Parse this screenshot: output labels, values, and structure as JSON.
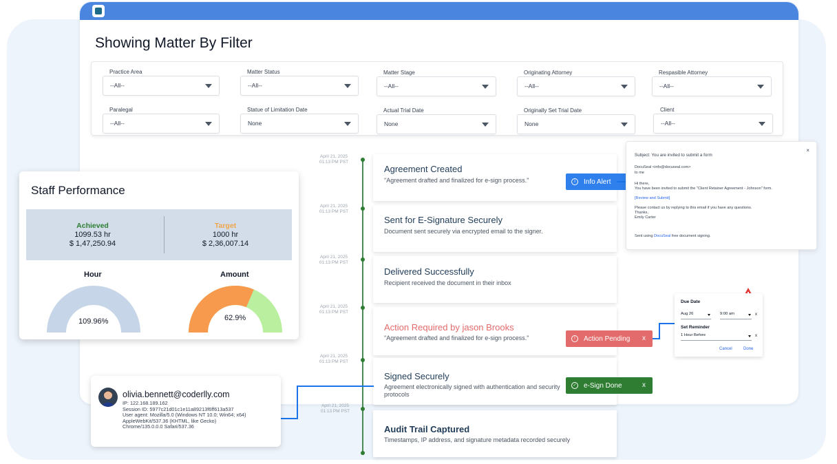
{
  "page_title": "Showing Matter By Filter",
  "filters": [
    {
      "label": "Practice Area",
      "value": "--All--"
    },
    {
      "label": "Matter Status",
      "value": "--All--"
    },
    {
      "label": "Matter Stage",
      "value": "--All--"
    },
    {
      "label": "Originating Attorney",
      "value": "--All--"
    },
    {
      "label": "Respasible Attorney",
      "value": "--All--"
    },
    {
      "label": "Paralegal",
      "value": "--All--"
    },
    {
      "label": "Statue of Limitation Date",
      "value": "None"
    },
    {
      "label": "Actual Trial Date",
      "value": "None"
    },
    {
      "label": "Originally Set Trial Date",
      "value": "None"
    },
    {
      "label": "Client",
      "value": "--All--"
    }
  ],
  "timeline": {
    "date_line1": "April 21, 2025",
    "date_line2": "01:13 PM PST",
    "events": [
      {
        "title": "Agreement Created",
        "desc": "\"Agreement drafted and finalized for e-sign process.\""
      },
      {
        "title": "Sent for E-Signature Securely",
        "desc": "Document sent securely via encrypted email to the signer."
      },
      {
        "title": "Delivered Successfully",
        "desc": "Recipient received the document in their inbox"
      },
      {
        "title": "Action Required by jason Brooks",
        "desc": "\"Agreement drafted and finalized for e-sign process.\""
      },
      {
        "title": "Signed Securely",
        "desc": "Agreement electronically signed with authentication and security protocols"
      },
      {
        "title": "Audit Trail Captured",
        "desc": "Timestamps, IP address, and signature metadata recorded securely"
      }
    ]
  },
  "chips": {
    "info": "Info Alert",
    "pending": "Action Pending",
    "done": "e-Sign Done",
    "close": "x"
  },
  "staff": {
    "title": "Staff Performance",
    "achieved_label": "Achieved",
    "achieved_hours": "1099.53 hr",
    "achieved_amount": "$ 1,47,250.94",
    "target_label": "Target",
    "target_hours": "1000 hr",
    "target_amount": "$ 2,36,007.14",
    "hour_label": "Hour",
    "hour_value": "109.96%",
    "amount_label": "Amount",
    "amount_value": "62.9%",
    "amount_fraction": 0.629
  },
  "email": {
    "close": "×",
    "subject": "Subject: You are invited to submit a form",
    "from": "DocuSeal <info@docuseal.com>",
    "to": "to me",
    "greeting": "Hi there,",
    "body": "You have been invited to submit the \"Client Retainer Agreement - Johnson\" form.",
    "link": "[Review and Submit]",
    "contact": "Please contact us by replying to this email if you have any questions.",
    "thanks": "Thanks,",
    "signoff": "Emily Carter",
    "footer_pre": "Sent using ",
    "footer_link": "DocuSeal",
    "footer_post": " free document signing."
  },
  "due": {
    "due_label": "Due Date",
    "date_value": "Aug 26",
    "time_value": "9:00 am",
    "reminder_label": "Set Reminder",
    "reminder_value": "1 Hour Before",
    "x": "x",
    "cancel": "Cancel",
    "done": "Done"
  },
  "user": {
    "email": "olivia.bennett@coderlly.com",
    "ip": "IP: 122.168.189.162",
    "session": "Session ID: 5977c21d01c1e11a89213f6ff613a537",
    "agent1": "User agent: Mozilla/5.0 (Windows NT 10.0; Win64; x64)",
    "agent2": "AppleWebKit/537.36 (KHTML, like Gecko)",
    "agent3": "Chrome/135.0.0.0 Safari/537.36"
  },
  "colors": {
    "topbar": "#4a86e0",
    "info": "#2f80ed",
    "pending": "#e46b6b",
    "done": "#2e7d32",
    "achieved": "#2e7d32",
    "target": "#f0a54a",
    "action_title": "#e46b6b"
  }
}
